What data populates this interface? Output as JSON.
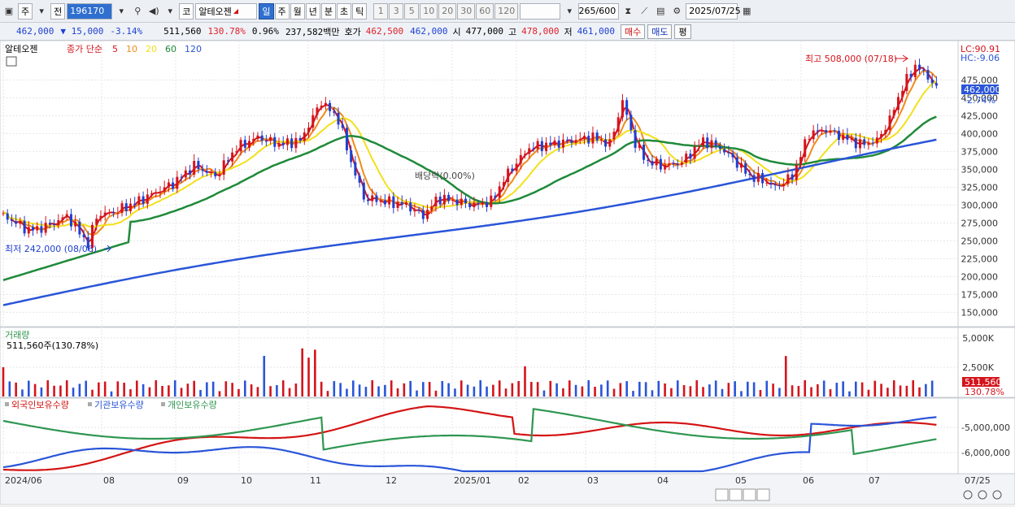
{
  "toolbar": {
    "period_label": "주",
    "prev_label": "전",
    "stock_code": "196170",
    "market_label": "코",
    "stock_name": "알테오젠",
    "tabs": [
      "일",
      "주",
      "월",
      "년",
      "분",
      "초",
      "틱"
    ],
    "active_tab": "일",
    "intervals": [
      "1",
      "3",
      "5",
      "10",
      "20",
      "30",
      "60",
      "120"
    ],
    "count": "265",
    "count_max": "/600",
    "date": "2025/07/25"
  },
  "quote": {
    "price": "462,000",
    "change": "▼ 15,000",
    "change_pct": "-3.14%",
    "volume": "511,560",
    "volume_pct": "130.78%",
    "turnover_pct": "0.96%",
    "amount": "237,582백만",
    "bid_label": "호가",
    "bid": "462,500",
    "ask": "462,000",
    "open_label": "시",
    "open": "477,000",
    "high_label": "고",
    "high": "478,000",
    "low_label": "저",
    "low": "461,000",
    "buy_label": "매수",
    "sell_label": "매도",
    "eval_label": "평"
  },
  "legend": {
    "name": "알테오젠",
    "ma_label": "종가 단순",
    "ma_periods": [
      "5",
      "10",
      "20",
      "60",
      "120"
    ],
    "ma_colors": [
      "#d4141c",
      "#f08a1a",
      "#f3e01a",
      "#1f8a3a",
      "#2a55d8"
    ]
  },
  "annotations": {
    "high": "최고 508,000 (07/18)",
    "low": "최저 242,000 (08/06)",
    "dividend": "배당락(0.00%)",
    "lc": "LC:90.91",
    "hc": "HC:-9.06",
    "current_price": "462,000",
    "current_pct": "-2.74%"
  },
  "volume_panel": {
    "title": "거래량",
    "value": "511,560주(130.78%)",
    "current": "511,560",
    "current_pct": "130.78%",
    "ticks": [
      "5,000K",
      "2,500K"
    ]
  },
  "holdings_panel": {
    "series": [
      "외국인보유수량",
      "기관보유수량",
      "개인보유수량"
    ],
    "colors": [
      "#d41414",
      "#2a55d8",
      "#2e9650"
    ],
    "ticks": [
      "-5,000,000",
      "-6,000,000"
    ]
  },
  "x_axis": {
    "labels": [
      "2024/06",
      "08",
      "09",
      "10",
      "11",
      "12",
      "2025/01",
      "02",
      "03",
      "04",
      "05",
      "06",
      "07"
    ],
    "right_label": "07/25"
  },
  "chart_data": {
    "type": "candlestick",
    "price_ticks": [
      "475,000",
      "450,000",
      "425,000",
      "400,000",
      "375,000",
      "350,000",
      "325,000",
      "300,000",
      "275,000",
      "250,000",
      "225,000",
      "200,000",
      "175,000",
      "150,000"
    ],
    "price_range": [
      130000,
      530000
    ],
    "close_series": [
      [
        0,
        285000
      ],
      [
        6,
        275000
      ],
      [
        12,
        265000
      ],
      [
        18,
        268000
      ],
      [
        24,
        275000
      ],
      [
        30,
        285000
      ],
      [
        36,
        262000
      ],
      [
        40,
        245000
      ],
      [
        44,
        285000
      ],
      [
        52,
        290000
      ],
      [
        60,
        300000
      ],
      [
        70,
        315000
      ],
      [
        80,
        330000
      ],
      [
        90,
        355000
      ],
      [
        100,
        340000
      ],
      [
        110,
        380000
      ],
      [
        120,
        395000
      ],
      [
        130,
        385000
      ],
      [
        140,
        390000
      ],
      [
        150,
        445000
      ],
      [
        158,
        420000
      ],
      [
        164,
        360000
      ],
      [
        170,
        310000
      ],
      [
        180,
        305000
      ],
      [
        190,
        300000
      ],
      [
        198,
        285000
      ],
      [
        205,
        310000
      ],
      [
        214,
        305000
      ],
      [
        222,
        300000
      ],
      [
        230,
        305000
      ],
      [
        238,
        345000
      ],
      [
        248,
        380000
      ],
      [
        258,
        385000
      ],
      [
        268,
        390000
      ],
      [
        278,
        395000
      ],
      [
        286,
        385000
      ],
      [
        292,
        445000
      ],
      [
        298,
        385000
      ],
      [
        304,
        360000
      ],
      [
        312,
        355000
      ],
      [
        320,
        360000
      ],
      [
        330,
        390000
      ],
      [
        338,
        380000
      ],
      [
        344,
        365000
      ],
      [
        352,
        340000
      ],
      [
        358,
        335000
      ],
      [
        364,
        325000
      ],
      [
        372,
        340000
      ],
      [
        380,
        400000
      ],
      [
        388,
        405000
      ],
      [
        396,
        395000
      ],
      [
        404,
        385000
      ],
      [
        412,
        390000
      ],
      [
        418,
        420000
      ],
      [
        424,
        465000
      ],
      [
        430,
        495000
      ],
      [
        436,
        480000
      ],
      [
        440,
        462000
      ]
    ],
    "ma_keys": [
      "5",
      "10",
      "20",
      "60",
      "120"
    ]
  }
}
